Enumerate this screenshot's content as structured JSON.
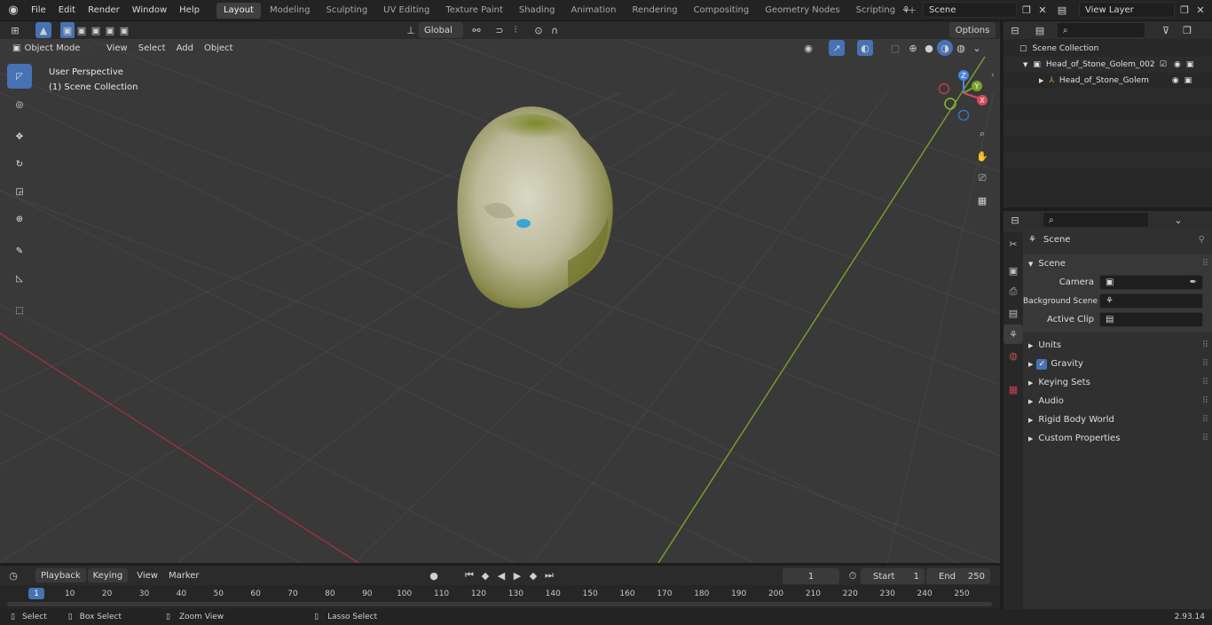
{
  "menu": [
    "File",
    "Edit",
    "Render",
    "Window",
    "Help"
  ],
  "workspaces": [
    "Layout",
    "Modeling",
    "Sculpting",
    "UV Editing",
    "Texture Paint",
    "Shading",
    "Animation",
    "Rendering",
    "Compositing",
    "Geometry Nodes",
    "Scripting"
  ],
  "active_workspace": "Layout",
  "scene_name": "Scene",
  "view_layer": "View Layer",
  "viewport": {
    "mode": "Object Mode",
    "menus": [
      "View",
      "Select",
      "Add",
      "Object"
    ],
    "orientation": "Global",
    "options_label": "Options",
    "overlay_title": "User Perspective",
    "overlay_sub": "(1) Scene Collection",
    "gizmo": {
      "z": "Z",
      "y": "Y",
      "x": "X"
    }
  },
  "outliner": {
    "root": "Scene Collection",
    "items": [
      {
        "name": "Head_of_Stone_Golem_002",
        "level": 1
      },
      {
        "name": "Head_of_Stone_Golem",
        "level": 2
      }
    ]
  },
  "properties": {
    "context": "Scene",
    "section": "Scene",
    "fields": [
      {
        "label": "Camera"
      },
      {
        "label": "Background Scene"
      },
      {
        "label": "Active Clip"
      }
    ],
    "panels": [
      "Units",
      "Gravity",
      "Keying Sets",
      "Audio",
      "Rigid Body World",
      "Custom Properties"
    ]
  },
  "timeline": {
    "menus": [
      "Playback",
      "Keying",
      "View",
      "Marker"
    ],
    "current_frame": "1",
    "start_label": "Start",
    "start": "1",
    "end_label": "End",
    "end": "250",
    "ticks": [
      "1",
      "10",
      "20",
      "30",
      "40",
      "50",
      "60",
      "70",
      "80",
      "90",
      "100",
      "110",
      "120",
      "130",
      "140",
      "150",
      "160",
      "170",
      "180",
      "190",
      "200",
      "210",
      "220",
      "230",
      "240",
      "250"
    ]
  },
  "status": {
    "items": [
      "Select",
      "Box Select",
      "Zoom View",
      "Lasso Select"
    ],
    "version": "2.93.14"
  }
}
